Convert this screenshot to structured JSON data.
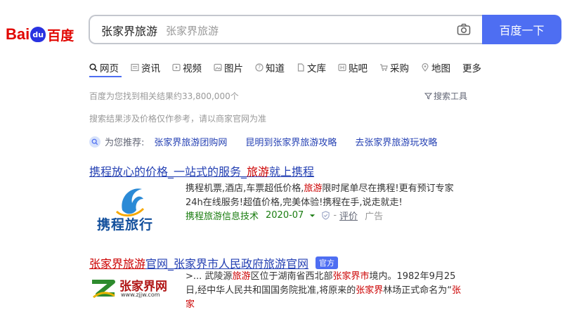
{
  "logo": {
    "bai": "Bai",
    "du": "du",
    "cn": "百度"
  },
  "search": {
    "query": "张家界旅游",
    "hint": "张家界旅游",
    "button_label": "百度一下"
  },
  "tabs": [
    {
      "label": "网页",
      "icon": "search-icon"
    },
    {
      "label": "资讯",
      "icon": "news-icon"
    },
    {
      "label": "视频",
      "icon": "video-icon"
    },
    {
      "label": "图片",
      "icon": "image-icon"
    },
    {
      "label": "知道",
      "icon": "question-icon"
    },
    {
      "label": "文库",
      "icon": "doc-icon"
    },
    {
      "label": "贴吧",
      "icon": "tieba-icon"
    },
    {
      "label": "采购",
      "icon": "cart-icon"
    },
    {
      "label": "地图",
      "icon": "map-icon"
    },
    {
      "label": "更多",
      "icon": ""
    }
  ],
  "result_count": "百度为您找到相关结果约33,800,000个",
  "search_tools": "搜索工具",
  "notice": "搜索结果涉及价格仅作参考，请以商家官网为准",
  "recommend": {
    "label": "为您推荐:",
    "items": [
      "张家界旅游团购网",
      "昆明到张家界旅游攻略",
      "去张家界旅游玩攻略"
    ]
  },
  "result1": {
    "title_a": "携程放心的价格_一站式的服务_",
    "title_hl": "旅游",
    "title_b": "就上携程",
    "logo_text": "携程旅行",
    "desc_a": "携程机票,酒店,车票超低价格,",
    "desc_hl": "旅游",
    "desc_b": "限时尾单尽在携程!更有预订专家24h在线服务!超值价格,完美体验!携程在手,说走就走!",
    "source": "携程旅游信息技术",
    "date": "2020-07",
    "rating": "评价",
    "ad": "广告"
  },
  "result2": {
    "title_hl": "张家界旅游",
    "title_a": "官网_张家界市人民政府旅游官网",
    "badge": "官方",
    "logo_text": "张家界网",
    "logo_url": "www.zjjw.com",
    "desc_1": ">... 武陵源",
    "desc_hl1": "旅游",
    "desc_2": "区位于湖南省西北部",
    "desc_hl2": "张家界市",
    "desc_3": "境内。1982年9月25日,经中华人民共和国国务院批准,将原来的",
    "desc_hl3": "张家界",
    "desc_4": "林场正式命名为“",
    "desc_hl4": "张家"
  }
}
